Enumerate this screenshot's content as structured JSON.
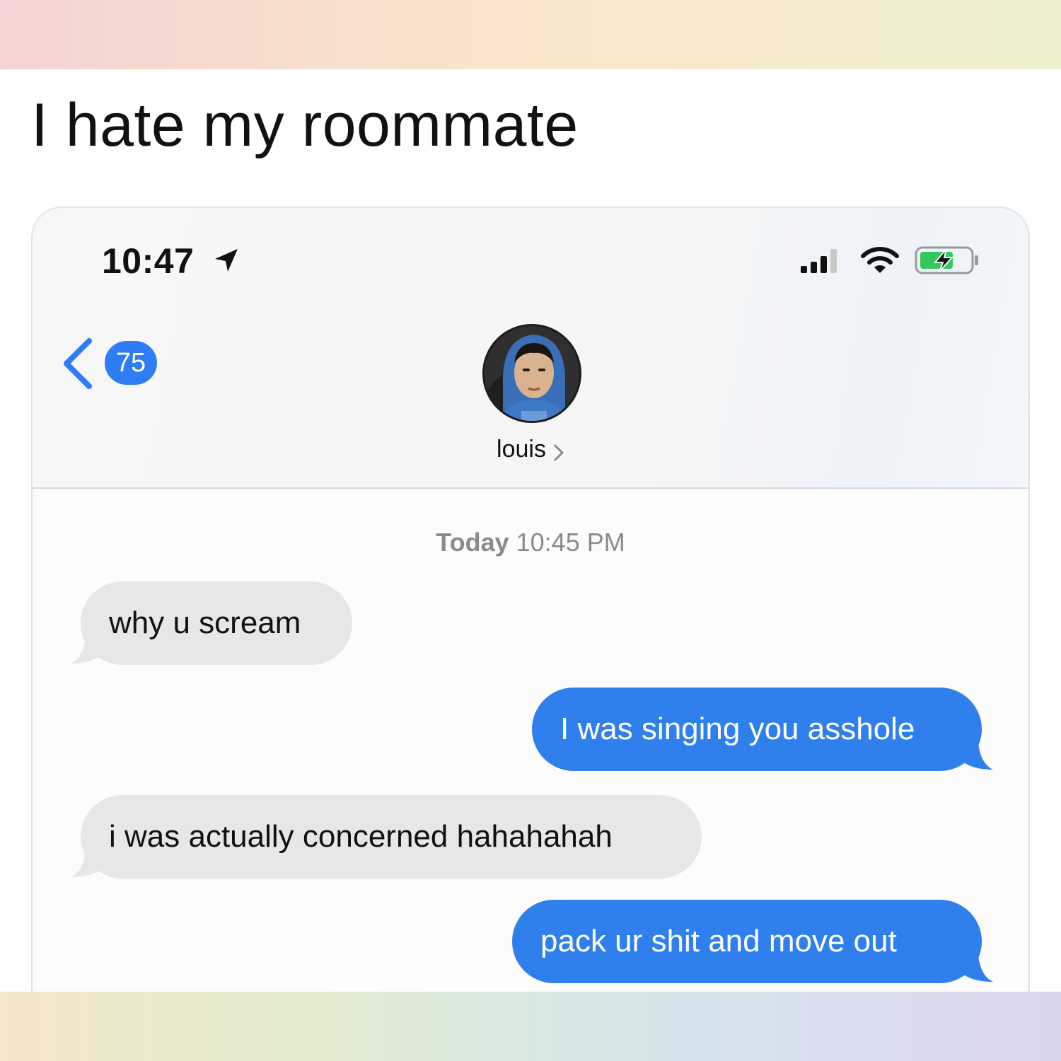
{
  "caption": "I hate my roommate",
  "status_bar": {
    "time": "10:47",
    "icons": [
      "location-arrow-icon",
      "cellular-signal-icon",
      "wifi-icon",
      "battery-charging-icon"
    ]
  },
  "nav": {
    "back_count": "75",
    "contact_name": "louis"
  },
  "conversation": {
    "timestamp_day": "Today",
    "timestamp_time": "10:45 PM",
    "messages": [
      {
        "direction": "incoming",
        "text": "why u scream"
      },
      {
        "direction": "outgoing",
        "text": "I was singing you asshole"
      },
      {
        "direction": "incoming",
        "text": "i was actually concerned hahahahah"
      },
      {
        "direction": "outgoing",
        "text": "pack ur shit and move out"
      }
    ]
  },
  "colors": {
    "outgoing_bubble": "#2f80ed",
    "incoming_bubble": "#e7e7ea",
    "ios_blue": "#2e7cf6"
  }
}
